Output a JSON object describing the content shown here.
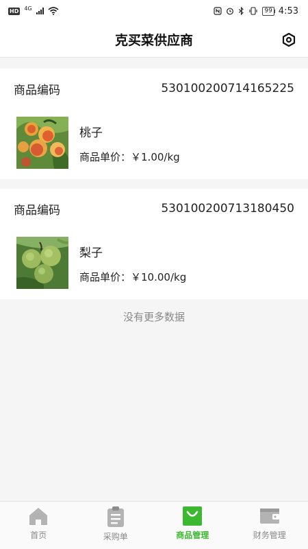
{
  "statusbar": {
    "hd": "HD",
    "network": "4G",
    "battery": "99",
    "time": "4:53"
  },
  "header": {
    "title": "克买菜供应商",
    "settings_icon": "hexagon-settings-icon"
  },
  "products": [
    {
      "code_label": "商品编码",
      "code": "530100200714165225",
      "name": "桃子",
      "price_label": "商品单价：",
      "price": "￥1.00/kg",
      "image": "peach-photo"
    },
    {
      "code_label": "商品编码",
      "code": "530100200713180450",
      "name": "梨子",
      "price_label": "商品单价：",
      "price": "￥10.00/kg",
      "image": "pear-photo"
    }
  ],
  "footer_note": "没有更多数据",
  "tabs": [
    {
      "label": "首页",
      "icon": "home-icon"
    },
    {
      "label": "采购单",
      "icon": "clipboard-icon"
    },
    {
      "label": "商品管理",
      "icon": "shopping-bag-icon",
      "active": true
    },
    {
      "label": "财务管理",
      "icon": "wallet-icon"
    }
  ],
  "colors": {
    "accent": "#3cb930",
    "inactive_icon": "#b3b3b3",
    "background": "#f5f5f5"
  }
}
